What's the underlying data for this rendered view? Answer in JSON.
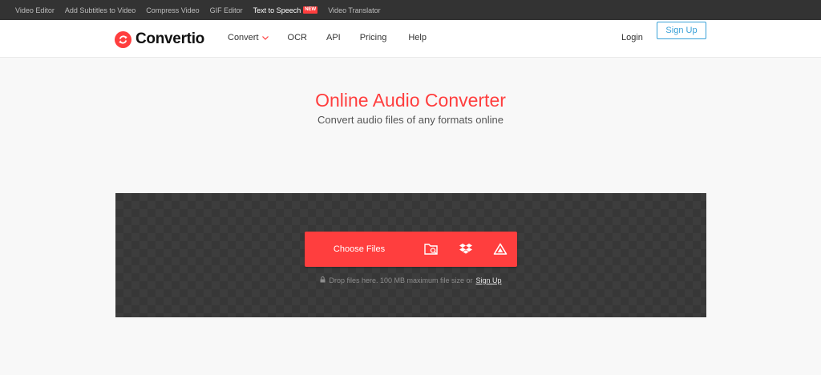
{
  "topbar": {
    "links": [
      {
        "label": "Video Editor",
        "active": false
      },
      {
        "label": "Add Subtitles to Video",
        "active": false
      },
      {
        "label": "Compress Video",
        "active": false
      },
      {
        "label": "GIF Editor",
        "active": false
      },
      {
        "label": "Text to Speech",
        "active": true,
        "badge": "NEW"
      },
      {
        "label": "Video Translator",
        "active": false
      }
    ]
  },
  "header": {
    "logo_text": "Convertio",
    "nav": {
      "convert": "Convert",
      "ocr": "OCR",
      "api": "API",
      "pricing": "Pricing",
      "help": "Help"
    },
    "login": "Login",
    "signup": "Sign Up"
  },
  "hero": {
    "title": "Online Audio Converter",
    "subtitle": "Convert audio files of any formats online"
  },
  "upload": {
    "choose_label": "Choose Files",
    "hint_text": "Drop files here. 100 MB maximum file size or",
    "hint_link": "Sign Up",
    "sources": [
      "folder-search-icon",
      "dropbox-icon",
      "google-drive-icon"
    ]
  },
  "colors": {
    "accent": "#ff3e3e",
    "signup_blue": "#3aa1d8",
    "topbar_bg": "#333333",
    "drop_area_bg": "#373737"
  }
}
